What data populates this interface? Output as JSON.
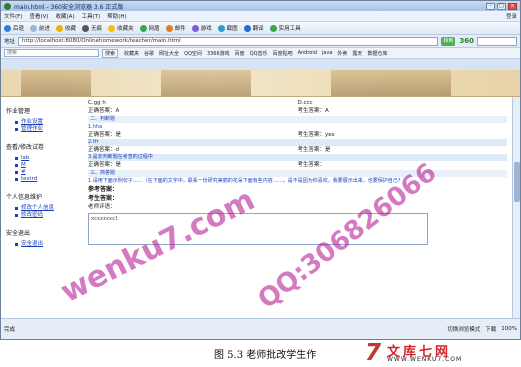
{
  "browser": {
    "window_title": "main.html - 360安全浏览器 3.6 正式版",
    "menu": [
      "文件(F)",
      "查看(V)",
      "收藏(A)",
      "工具(T)",
      "帮助(H)"
    ],
    "login": "登录",
    "toolbar": [
      "后退",
      "前进",
      "收藏",
      "无痕",
      "收藏夹",
      "网盾",
      "邮件",
      "游戏",
      "截图",
      "翻译",
      "实用工具"
    ],
    "address_label": "地址",
    "address": "http://localhost:8080/Onlinehomework/teacher/main.html",
    "go_label": "转到",
    "brand": "360",
    "search_placeholder": "搜索",
    "search_button": "搜索",
    "favorites": [
      "收藏夹",
      "谷歌",
      "网址大全",
      "QQ空间",
      "3366游戏",
      "百度",
      "QQ音乐",
      "百度贴吧",
      "Android",
      "java",
      "外卖",
      "露天",
      "数据仓库"
    ],
    "status_left": "完成",
    "status_items": [
      "切换浏览模式",
      "下载",
      "100%"
    ]
  },
  "sidebar": {
    "sections": [
      {
        "title": "作业管理",
        "links": [
          "作业设置",
          "管理作业"
        ]
      },
      {
        "title": "查看/修改试卷",
        "links": [
          "lab",
          "M",
          "#",
          "testrd"
        ]
      },
      {
        "title": "个人信息维护",
        "links": [
          "修改个人信息",
          "修改密码"
        ]
      },
      {
        "title": "安全退出",
        "links": [
          "安全退出"
        ]
      }
    ]
  },
  "content": {
    "opt_c": "C.gg h",
    "opt_d": "D.ccc",
    "correct1": "正确答案：A",
    "student1": "考生答案：A",
    "sect_tf": "二、判断题",
    "q1": "1.hha",
    "correct2": "正确答案：是",
    "student2": "考生答案：yes",
    "q2": "2.tfr",
    "correct3": "正确答案：d",
    "student3": "考生答案：是",
    "q3": "3.是非判断题在考查的过程中",
    "correct4": "正确答案：是",
    "student4": "考生答案：",
    "sect_essay": "三、简答题",
    "q4": "1.请用下面示例句子……（在下面的文字中，联系一份研究美丽的花朵下面有些内容……，是不是因为你喜欢，我要展示出来，也要保护自己?",
    "ref_answer": "参考答案：",
    "stu_answer": "考生答案：",
    "teacher_comment": "老师评语：",
    "comment_text": "xcxzzzxcl"
  },
  "watermarks": [
    "wenku7.com",
    "QQ:306826066"
  ],
  "caption": {
    "text": "图 5.3 老师批改学生作",
    "logo_mark": "7",
    "logo_name": "文库七网",
    "logo_url": "WWW.WENKU7.COM"
  }
}
